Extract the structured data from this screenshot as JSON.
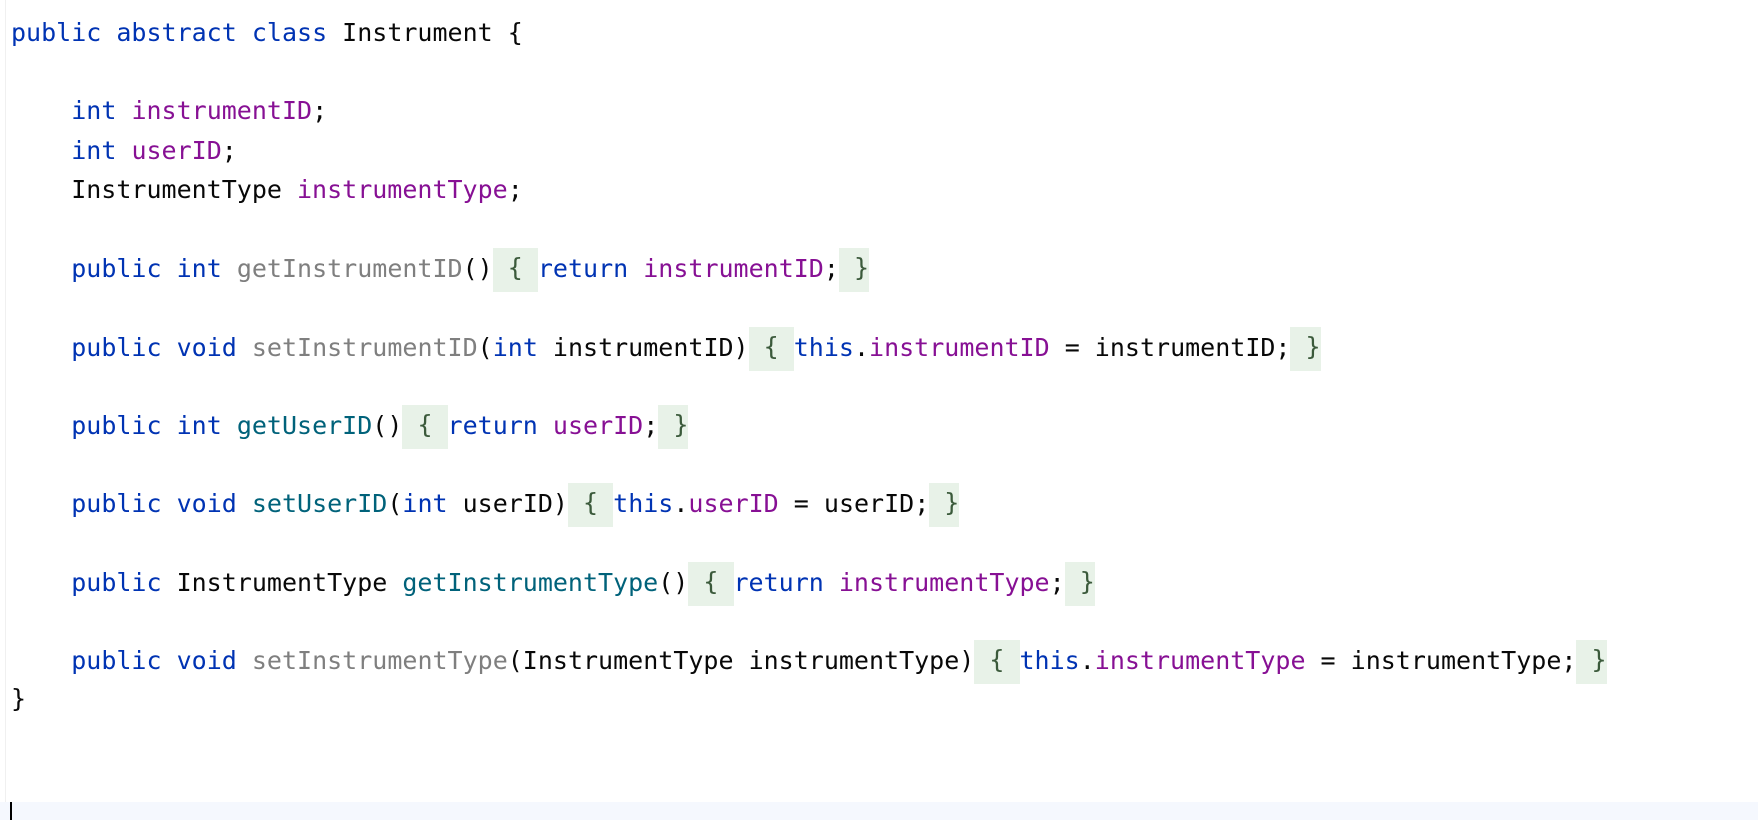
{
  "editor": {
    "language": "java",
    "colors": {
      "keyword": "#0033b3",
      "field": "#871094",
      "method_used": "#00627a",
      "method_unused": "#7f7f7f",
      "fold_background": "#e8f2e8",
      "current_line": "#f5f8fe"
    },
    "lines": [
      {
        "tokens": [
          {
            "text": "public",
            "kind": "kw"
          },
          {
            "text": " ",
            "kind": "plain"
          },
          {
            "text": "abstract",
            "kind": "kw"
          },
          {
            "text": " ",
            "kind": "plain"
          },
          {
            "text": "class",
            "kind": "kw"
          },
          {
            "text": " Instrument {",
            "kind": "plain"
          }
        ]
      },
      {
        "tokens": []
      },
      {
        "tokens": [
          {
            "text": "    ",
            "kind": "plain"
          },
          {
            "text": "int",
            "kind": "kw"
          },
          {
            "text": " ",
            "kind": "plain"
          },
          {
            "text": "instrumentID",
            "kind": "field"
          },
          {
            "text": ";",
            "kind": "plain"
          }
        ]
      },
      {
        "tokens": [
          {
            "text": "    ",
            "kind": "plain"
          },
          {
            "text": "int",
            "kind": "kw"
          },
          {
            "text": " ",
            "kind": "plain"
          },
          {
            "text": "userID",
            "kind": "field"
          },
          {
            "text": ";",
            "kind": "plain"
          }
        ]
      },
      {
        "tokens": [
          {
            "text": "    InstrumentType ",
            "kind": "plain"
          },
          {
            "text": "instrumentType",
            "kind": "field"
          },
          {
            "text": ";",
            "kind": "plain"
          }
        ]
      },
      {
        "tokens": []
      },
      {
        "tokens": [
          {
            "text": "    ",
            "kind": "plain"
          },
          {
            "text": "public",
            "kind": "kw"
          },
          {
            "text": " ",
            "kind": "plain"
          },
          {
            "text": "int",
            "kind": "kw"
          },
          {
            "text": " ",
            "kind": "plain"
          },
          {
            "text": "getInstrumentID",
            "kind": "m-unused"
          },
          {
            "text": "()",
            "kind": "plain"
          },
          {
            "text": " { ",
            "kind": "fold"
          },
          {
            "text": "return",
            "kind": "kw"
          },
          {
            "text": " ",
            "kind": "plain"
          },
          {
            "text": "instrumentID",
            "kind": "field"
          },
          {
            "text": ";",
            "kind": "plain"
          },
          {
            "text": " }",
            "kind": "fold"
          }
        ]
      },
      {
        "tokens": []
      },
      {
        "tokens": [
          {
            "text": "    ",
            "kind": "plain"
          },
          {
            "text": "public",
            "kind": "kw"
          },
          {
            "text": " ",
            "kind": "plain"
          },
          {
            "text": "void",
            "kind": "kw"
          },
          {
            "text": " ",
            "kind": "plain"
          },
          {
            "text": "setInstrumentID",
            "kind": "m-unused"
          },
          {
            "text": "(",
            "kind": "plain"
          },
          {
            "text": "int",
            "kind": "kw"
          },
          {
            "text": " instrumentID)",
            "kind": "plain"
          },
          {
            "text": " { ",
            "kind": "fold"
          },
          {
            "text": "this",
            "kind": "kw"
          },
          {
            "text": ".",
            "kind": "plain"
          },
          {
            "text": "instrumentID",
            "kind": "field"
          },
          {
            "text": " = instrumentID;",
            "kind": "plain"
          },
          {
            "text": " }",
            "kind": "fold"
          }
        ]
      },
      {
        "tokens": []
      },
      {
        "tokens": [
          {
            "text": "    ",
            "kind": "plain"
          },
          {
            "text": "public",
            "kind": "kw"
          },
          {
            "text": " ",
            "kind": "plain"
          },
          {
            "text": "int",
            "kind": "kw"
          },
          {
            "text": " ",
            "kind": "plain"
          },
          {
            "text": "getUserID",
            "kind": "m-used"
          },
          {
            "text": "()",
            "kind": "plain"
          },
          {
            "text": " { ",
            "kind": "fold"
          },
          {
            "text": "return",
            "kind": "kw"
          },
          {
            "text": " ",
            "kind": "plain"
          },
          {
            "text": "userID",
            "kind": "field"
          },
          {
            "text": ";",
            "kind": "plain"
          },
          {
            "text": " }",
            "kind": "fold"
          }
        ]
      },
      {
        "tokens": []
      },
      {
        "tokens": [
          {
            "text": "    ",
            "kind": "plain"
          },
          {
            "text": "public",
            "kind": "kw"
          },
          {
            "text": " ",
            "kind": "plain"
          },
          {
            "text": "void",
            "kind": "kw"
          },
          {
            "text": " ",
            "kind": "plain"
          },
          {
            "text": "setUserID",
            "kind": "m-used"
          },
          {
            "text": "(",
            "kind": "plain"
          },
          {
            "text": "int",
            "kind": "kw"
          },
          {
            "text": " userID)",
            "kind": "plain"
          },
          {
            "text": " { ",
            "kind": "fold"
          },
          {
            "text": "this",
            "kind": "kw"
          },
          {
            "text": ".",
            "kind": "plain"
          },
          {
            "text": "userID",
            "kind": "field"
          },
          {
            "text": " = userID;",
            "kind": "plain"
          },
          {
            "text": " }",
            "kind": "fold"
          }
        ]
      },
      {
        "tokens": []
      },
      {
        "tokens": [
          {
            "text": "    ",
            "kind": "plain"
          },
          {
            "text": "public",
            "kind": "kw"
          },
          {
            "text": " InstrumentType ",
            "kind": "plain"
          },
          {
            "text": "getInstrumentType",
            "kind": "m-used"
          },
          {
            "text": "()",
            "kind": "plain"
          },
          {
            "text": " { ",
            "kind": "fold"
          },
          {
            "text": "return",
            "kind": "kw"
          },
          {
            "text": " ",
            "kind": "plain"
          },
          {
            "text": "instrumentType",
            "kind": "field"
          },
          {
            "text": ";",
            "kind": "plain"
          },
          {
            "text": " }",
            "kind": "fold"
          }
        ]
      },
      {
        "tokens": []
      },
      {
        "tokens": [
          {
            "text": "    ",
            "kind": "plain"
          },
          {
            "text": "public",
            "kind": "kw"
          },
          {
            "text": " ",
            "kind": "plain"
          },
          {
            "text": "void",
            "kind": "kw"
          },
          {
            "text": " ",
            "kind": "plain"
          },
          {
            "text": "setInstrumentType",
            "kind": "m-unused"
          },
          {
            "text": "(InstrumentType instrumentType)",
            "kind": "plain"
          },
          {
            "text": " { ",
            "kind": "fold"
          },
          {
            "text": "this",
            "kind": "kw"
          },
          {
            "text": ".",
            "kind": "plain"
          },
          {
            "text": "instrumentType",
            "kind": "field"
          },
          {
            "text": " = instrumentType;",
            "kind": "plain"
          },
          {
            "text": " }",
            "kind": "fold"
          }
        ]
      },
      {
        "tokens": [
          {
            "text": "}",
            "kind": "plain"
          }
        ]
      }
    ]
  }
}
